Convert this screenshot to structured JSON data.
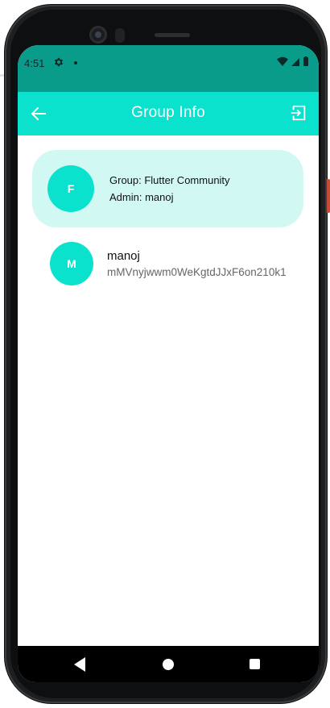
{
  "statusbar": {
    "time": "4:51",
    "icons": [
      "gear-icon",
      "notification-dot",
      "wifi-icon",
      "signal-icon",
      "battery-icon"
    ]
  },
  "appbar": {
    "title": "Group Info",
    "back_icon": "arrow-left-icon",
    "exit_icon": "exit-icon"
  },
  "group": {
    "avatar_letter": "F",
    "name_line": "Group: Flutter Community",
    "admin_line": "Admin: manoj"
  },
  "members": [
    {
      "avatar_letter": "M",
      "name": "manoj",
      "id": "mMVnyjwwm0WeKgtdJJxF6on210k1"
    }
  ],
  "colors": {
    "statusbar": "#0a9c8b",
    "appbar": "#0ae2cd",
    "card": "#d2f8f4",
    "avatar": "#0ae2cd"
  }
}
